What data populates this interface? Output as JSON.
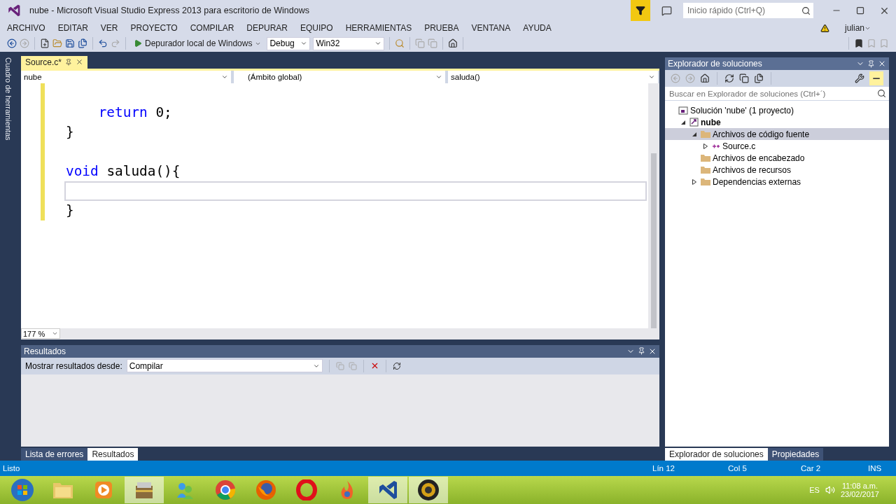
{
  "window": {
    "title": "nube - Microsoft Visual Studio Express 2013 para escritorio de Windows"
  },
  "quick_launch": {
    "placeholder": "Inicio rápido (Ctrl+Q)"
  },
  "user": {
    "name": "julian"
  },
  "menu": [
    "ARCHIVO",
    "EDITAR",
    "VER",
    "PROYECTO",
    "COMPILAR",
    "DEPURAR",
    "EQUIPO",
    "HERRAMIENTAS",
    "PRUEBA",
    "VENTANA",
    "AYUDA"
  ],
  "toolbar": {
    "debugger": "Depurador local de Windows",
    "configuration": "Debug",
    "platform": "Win32"
  },
  "toolbox_strip": {
    "label": "Cuadro de herramientas"
  },
  "editor": {
    "tabs": [
      {
        "label": "Source.c*",
        "selected": true
      }
    ],
    "nav": [
      "nube",
      "(Ámbito global)",
      "saluda()"
    ],
    "lines": [
      {
        "changed": true,
        "current": false
      },
      {
        "changed": true,
        "current": false,
        "tokens": [
          {
            "kind": "keyword",
            "text": "    return"
          },
          {
            "kind": "plain",
            "text": " 0;"
          }
        ]
      },
      {
        "changed": true,
        "current": false,
        "tokens": [
          {
            "kind": "plain",
            "text": "}"
          }
        ]
      },
      {
        "changed": true,
        "current": false
      },
      {
        "changed": true,
        "current": false,
        "tokens": [
          {
            "kind": "keyword",
            "text": "void"
          },
          {
            "kind": "plain",
            "text": " saluda(){"
          }
        ]
      },
      {
        "changed": true,
        "current": true
      },
      {
        "changed": true,
        "current": false,
        "tokens": [
          {
            "kind": "plain",
            "text": "}"
          }
        ]
      }
    ],
    "zoom": "177 %"
  },
  "output": {
    "title": "Resultados",
    "show_from_label": "Mostrar resultados desde:",
    "source": "Compilar",
    "tabs": [
      {
        "label": "Lista de errores",
        "selected": false
      },
      {
        "label": "Resultados",
        "selected": true
      }
    ]
  },
  "solution_explorer": {
    "title": "Explorador de soluciones",
    "search": {
      "placeholder": "Buscar en Explorador de soluciones (Ctrl+´)"
    },
    "tree": [
      {
        "kind": "solution",
        "label": "Solución 'nube'  (1 proyecto)",
        "selected": false,
        "children": [
          {
            "kind": "project",
            "label": "nube",
            "selected": false,
            "expanded": true,
            "children": [
              {
                "kind": "folder",
                "label": "Archivos de código fuente",
                "selected": true,
                "expanded": true,
                "children": [
                  {
                    "kind": "file",
                    "label": "Source.c",
                    "selected": false,
                    "expanded": false
                  }
                ]
              },
              {
                "kind": "folder",
                "label": "Archivos de encabezado",
                "selected": false
              },
              {
                "kind": "folder",
                "label": "Archivos de recursos",
                "selected": false
              },
              {
                "kind": "folder",
                "label": "Dependencias externas",
                "selected": false,
                "expanded": false
              }
            ]
          }
        ]
      }
    ],
    "tabs": [
      {
        "label": "Explorador de soluciones",
        "selected": true
      },
      {
        "label": "Propiedades",
        "selected": false
      }
    ]
  },
  "status_bar": {
    "message": "Listo",
    "line": "Lín 12",
    "column": "Col 5",
    "char": "Car 2",
    "mode": "INS"
  },
  "taskbar": {
    "language": "ES",
    "time": "11:08 a.m.",
    "date": "23/02/2017"
  }
}
